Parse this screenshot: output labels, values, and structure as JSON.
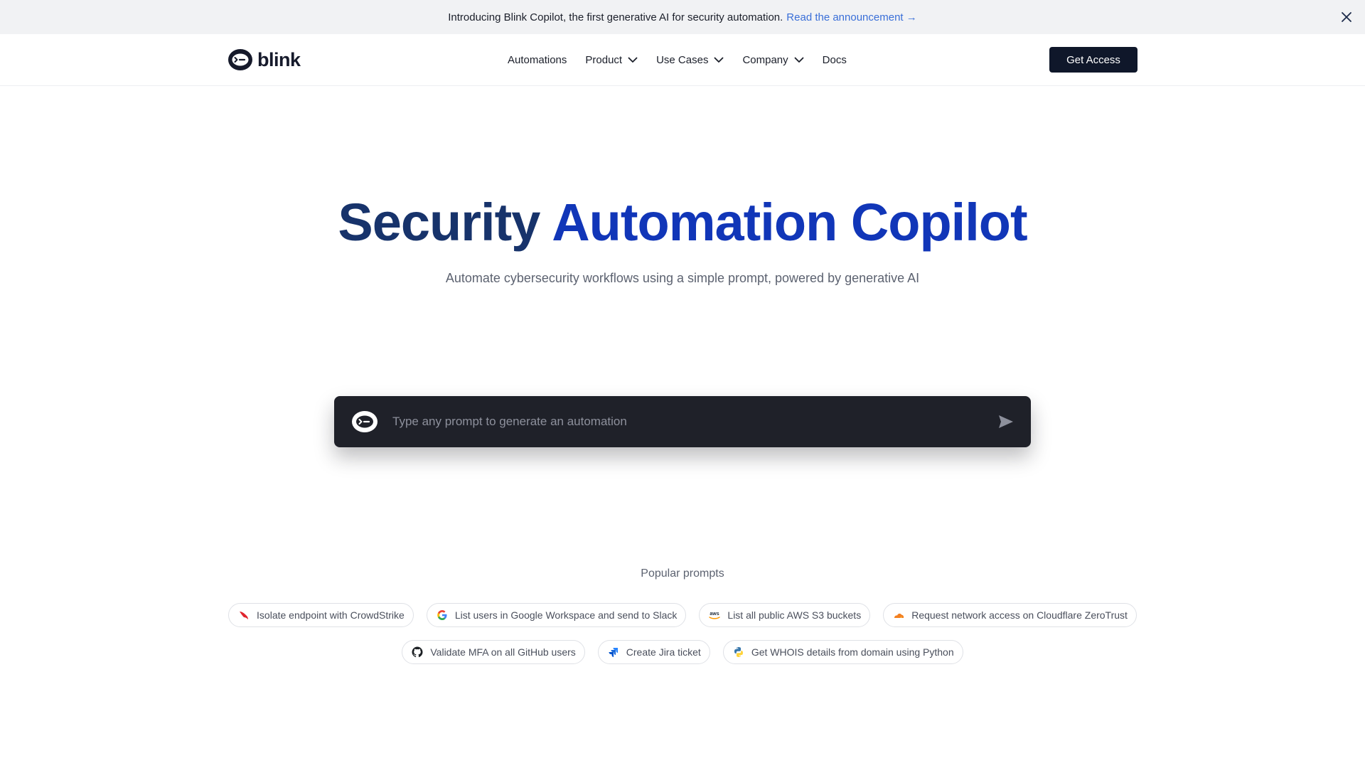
{
  "announcement": {
    "text": "Introducing Blink Copilot, the first generative AI for security automation.",
    "link": "Read the announcement →"
  },
  "brand": {
    "name": "blink"
  },
  "nav": {
    "items": [
      {
        "label": "Automations",
        "dropdown": false
      },
      {
        "label": "Product",
        "dropdown": true
      },
      {
        "label": "Use Cases",
        "dropdown": true
      },
      {
        "label": "Company",
        "dropdown": true
      },
      {
        "label": "Docs",
        "dropdown": false
      }
    ],
    "cta": "Get Access"
  },
  "hero": {
    "title_part1": "Security",
    "title_part2": "Automation Copilot",
    "subtitle": "Automate cybersecurity workflows using a simple prompt, powered by generative AI"
  },
  "prompt": {
    "placeholder": "Type any prompt to generate an automation",
    "value": ""
  },
  "popular": {
    "label": "Popular prompts",
    "row1": [
      {
        "label": "Isolate endpoint with CrowdStrike",
        "icon": "crowdstrike-icon"
      },
      {
        "label": "List users in Google Workspace and send to Slack",
        "icon": "google-icon"
      },
      {
        "label": "List all public AWS S3 buckets",
        "icon": "aws-icon"
      },
      {
        "label": "Request network access on Cloudflare ZeroTrust",
        "icon": "cloudflare-icon"
      }
    ],
    "row2": [
      {
        "label": "Validate MFA on all GitHub users",
        "icon": "github-icon"
      },
      {
        "label": "Create Jira ticket",
        "icon": "jira-icon"
      },
      {
        "label": "Get WHOIS details from domain using Python",
        "icon": "python-icon"
      }
    ],
    "aws_icon_text": "aws"
  },
  "colors": {
    "title_dark": "#17336b",
    "title_blue": "#1136b8",
    "cta_bg": "#0f172a",
    "prompt_bg": "#1f2129",
    "link": "#3a6fd8"
  }
}
